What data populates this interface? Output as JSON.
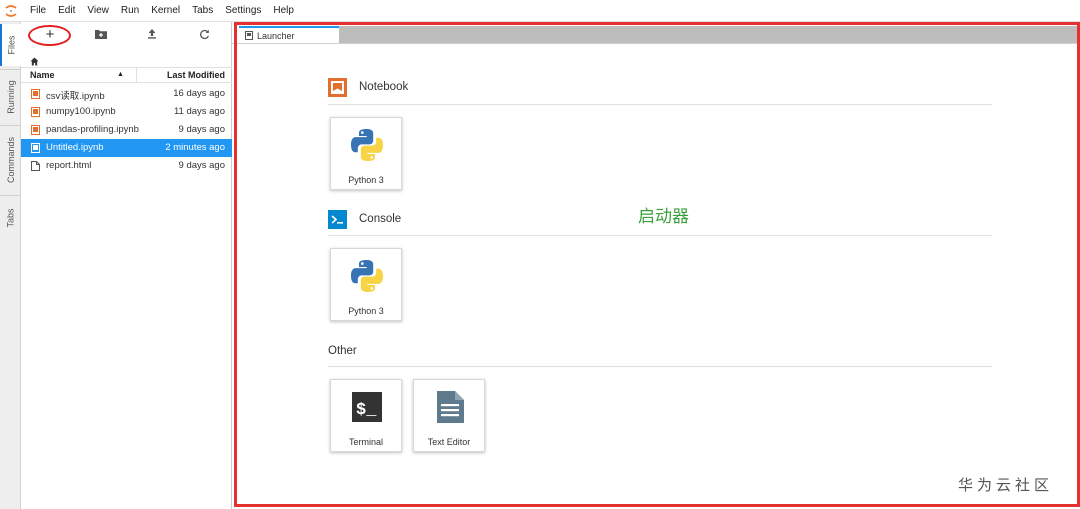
{
  "menubar": {
    "items": [
      "File",
      "Edit",
      "View",
      "Run",
      "Kernel",
      "Tabs",
      "Settings",
      "Help"
    ]
  },
  "left_tabs": [
    "Files",
    "Running",
    "Commands",
    "Tabs"
  ],
  "file_browser": {
    "toolbar": {
      "new_label": "+",
      "new_folder_icon": "new-folder-icon",
      "upload_icon": "upload-icon",
      "refresh_icon": "refresh-icon"
    },
    "columns": {
      "name": "Name",
      "modified": "Last Modified"
    },
    "files": [
      {
        "name": "csv读取.ipynb",
        "modified": "16 days ago",
        "type": "notebook",
        "selected": false
      },
      {
        "name": "numpy100.ipynb",
        "modified": "11 days ago",
        "type": "notebook",
        "selected": false
      },
      {
        "name": "pandas-profiling.ipynb",
        "modified": "9 days ago",
        "type": "notebook",
        "selected": false
      },
      {
        "name": "Untitled.ipynb",
        "modified": "2 minutes ago",
        "type": "notebook",
        "selected": true
      },
      {
        "name": "report.html",
        "modified": "9 days ago",
        "type": "file",
        "selected": false
      }
    ]
  },
  "main": {
    "tab": {
      "label": "Launcher"
    },
    "sections": {
      "notebook": {
        "title": "Notebook",
        "cards": [
          {
            "label": "Python 3",
            "icon": "python-icon"
          }
        ]
      },
      "console": {
        "title": "Console",
        "cards": [
          {
            "label": "Python 3",
            "icon": "python-icon"
          }
        ]
      },
      "other": {
        "title": "Other",
        "cards": [
          {
            "label": "Terminal",
            "icon": "terminal-icon"
          },
          {
            "label": "Text Editor",
            "icon": "text-editor-icon"
          }
        ]
      }
    },
    "annotation": "启动器",
    "watermark": "华为云社区"
  },
  "colors": {
    "accent": "#2196f3",
    "notebook_orange": "#e46e2e",
    "console_blue": "#0288d1",
    "highlight_red": "#e53030",
    "annotation_green": "#3aa13a"
  }
}
